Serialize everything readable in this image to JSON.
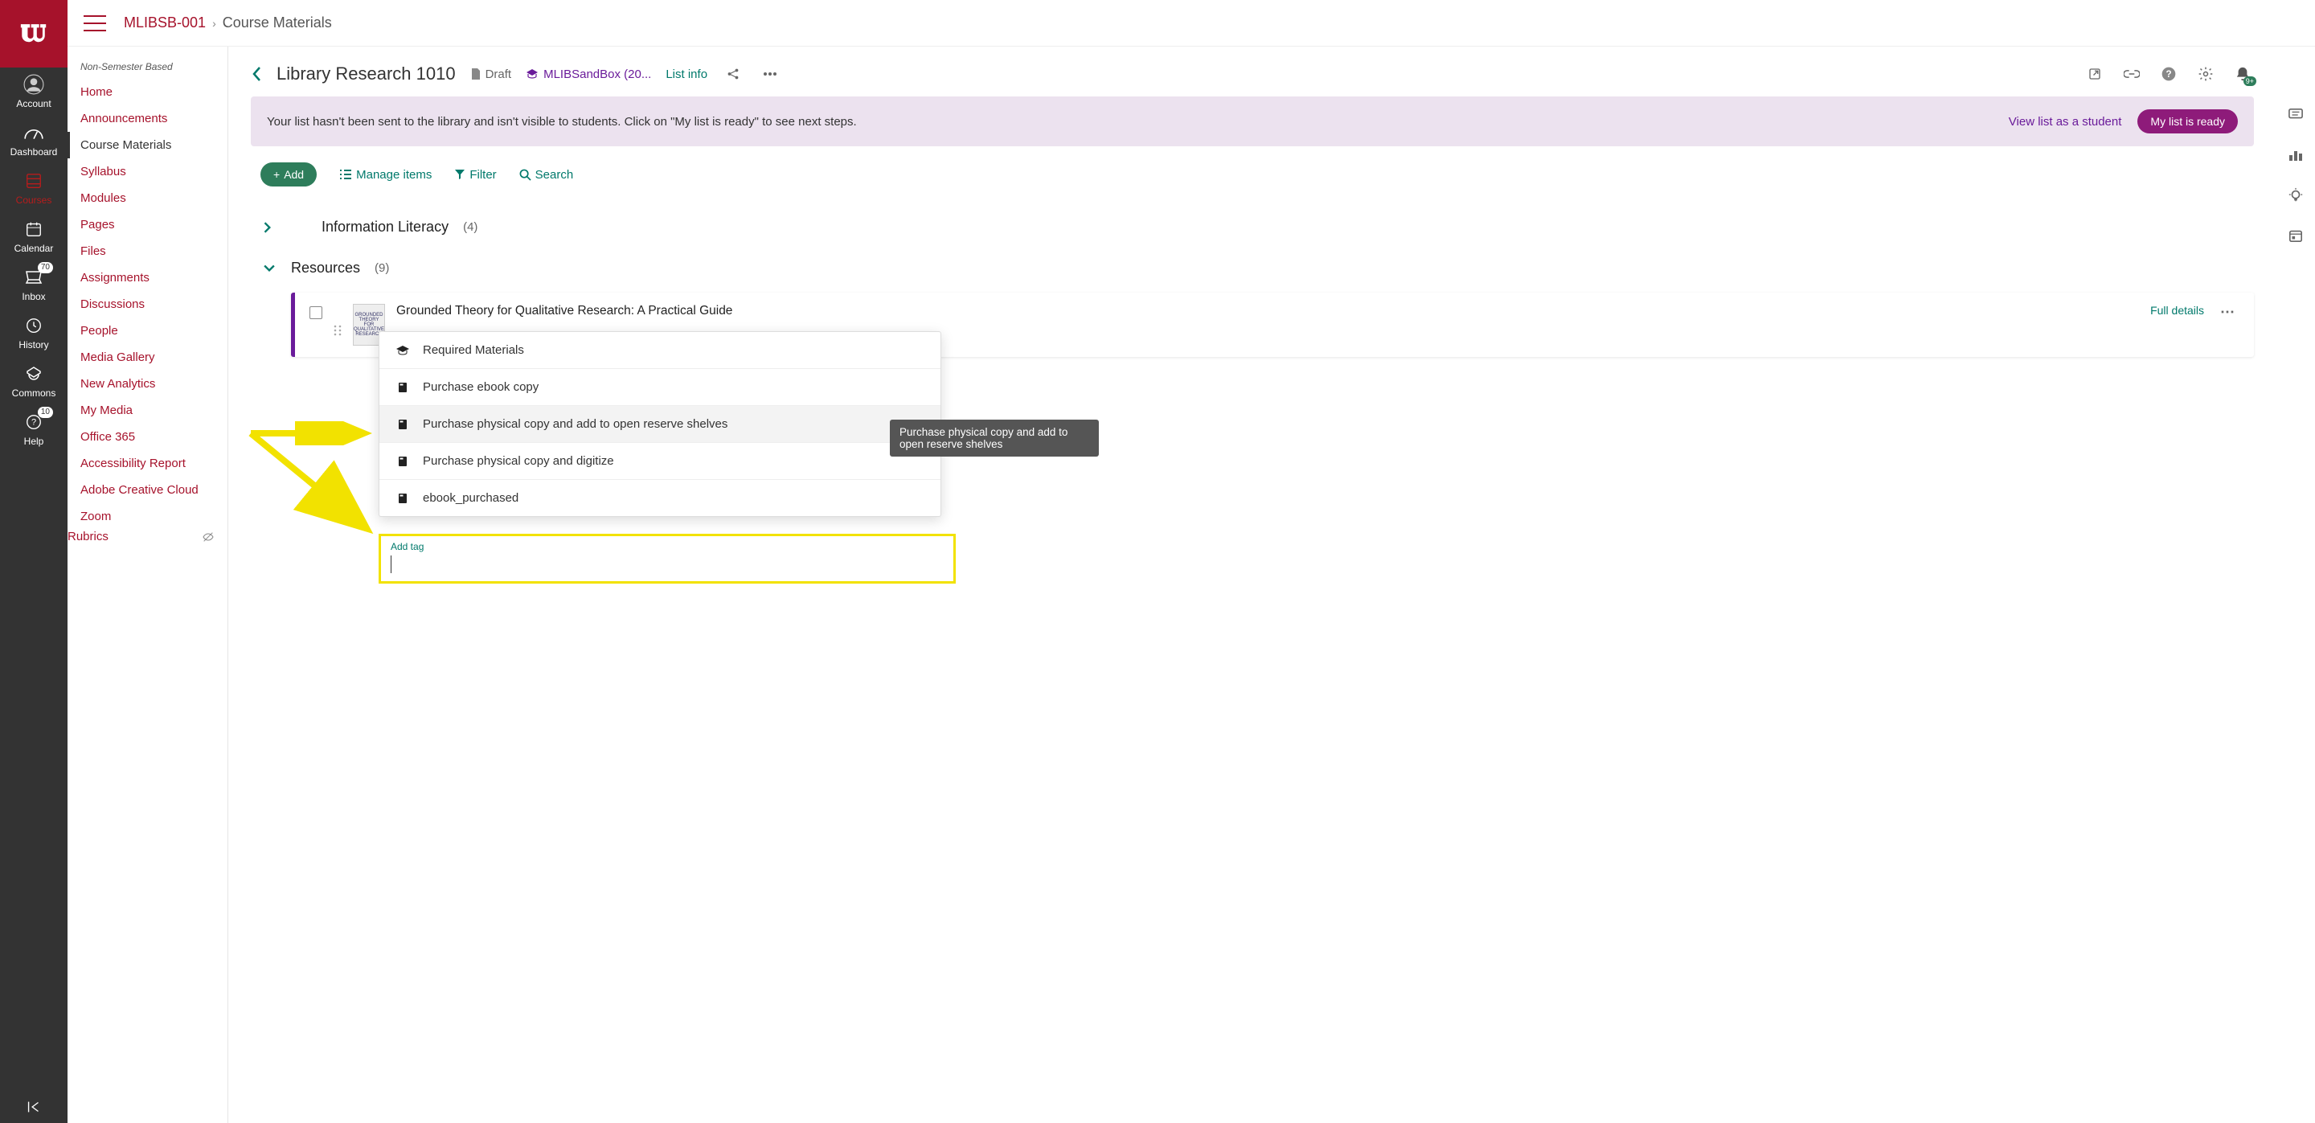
{
  "appnav": {
    "items": [
      {
        "label": "Account"
      },
      {
        "label": "Dashboard"
      },
      {
        "label": "Courses"
      },
      {
        "label": "Calendar"
      },
      {
        "label": "Inbox",
        "badge": "70"
      },
      {
        "label": "History"
      },
      {
        "label": "Commons"
      },
      {
        "label": "Help",
        "badge": "10"
      }
    ]
  },
  "breadcrumb": {
    "course": "MLIBSB-001",
    "page": "Course Materials"
  },
  "coursenav": {
    "semester": "Non-Semester Based",
    "items": [
      "Home",
      "Announcements",
      "Course Materials",
      "Syllabus",
      "Modules",
      "Pages",
      "Files",
      "Assignments",
      "Discussions",
      "People",
      "Media Gallery",
      "New Analytics",
      "My Media",
      "Office 365",
      "Accessibility Report",
      "Adobe Creative Cloud",
      "Zoom",
      "Rubrics"
    ]
  },
  "list": {
    "title": "Library Research 1010",
    "status": "Draft",
    "course": "MLIBSandBox (20...",
    "info_label": "List info"
  },
  "banner": {
    "text": "Your list hasn't been sent to the library and isn't visible to students. Click on \"My list is ready\" to see next steps.",
    "view_link": "View list as a student",
    "ready_btn": "My list is ready"
  },
  "toolbar": {
    "add": "Add",
    "manage": "Manage items",
    "filter": "Filter",
    "search": "Search"
  },
  "sections": [
    {
      "title": "Information Literacy",
      "count": "(4)"
    },
    {
      "title": "Resources",
      "count": "(9)"
    }
  ],
  "item": {
    "title": "Grounded Theory for Qualitative Research: A Practical Guide",
    "full_details": "Full details",
    "thumb_text": "GROUNDED THEORY FOR QUALITATIVE RESEARCH"
  },
  "dropdown": {
    "items": [
      {
        "label": "Required Materials",
        "icon": "cap"
      },
      {
        "label": "Purchase ebook copy",
        "icon": "book"
      },
      {
        "label": "Purchase physical copy and add to open reserve shelves",
        "icon": "book"
      },
      {
        "label": "Purchase physical copy and digitize",
        "icon": "book"
      },
      {
        "label": "ebook_purchased",
        "icon": "book"
      }
    ]
  },
  "tooltip": "Purchase physical copy and add to open reserve shelves",
  "addtag": {
    "label": "Add tag",
    "placeholder": ""
  },
  "notif_badge": "9+"
}
